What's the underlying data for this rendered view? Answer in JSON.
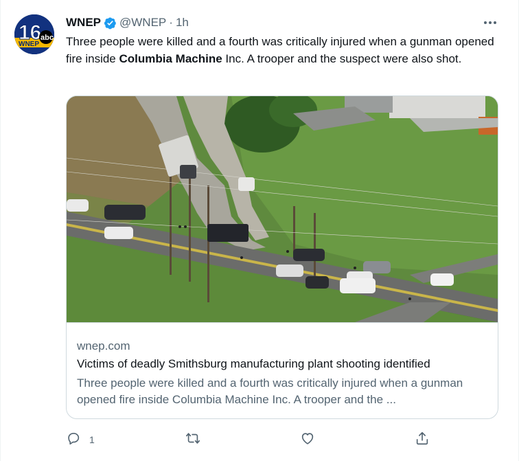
{
  "tweet": {
    "display_name": "WNEP",
    "verified": true,
    "handle": "@WNEP",
    "separator": "·",
    "time": "1h",
    "text_before": "Three people were killed and a fourth was critically injured when a gunman opened fire inside ",
    "text_bold": "Columbia Machine",
    "text_after": " Inc. A trooper and the suspect were also shot.",
    "avatar": {
      "number": "16",
      "network": "abc",
      "callsign": "WNEP"
    }
  },
  "card": {
    "domain": "wnep.com",
    "title": "Victims of deadly Smithsburg manufacturing plant shooting identified",
    "description": "Three people were killed and a fourth was critically injured when a gunman opened fire inside Columbia Machine Inc. A trooper and the ..."
  },
  "actions": {
    "reply_count": "1",
    "retweet_count": "",
    "like_count": ""
  },
  "colors": {
    "text_primary": "#0f1419",
    "text_secondary": "#536471",
    "verified_blue": "#1d9bf0",
    "border": "#cfd9de"
  },
  "icons": [
    "verified-badge-icon",
    "more-options-icon",
    "reply-icon",
    "retweet-icon",
    "like-icon",
    "share-icon"
  ]
}
